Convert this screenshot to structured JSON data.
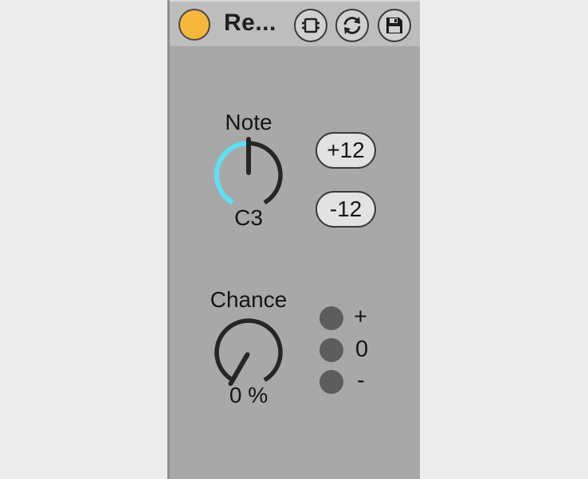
{
  "device": {
    "title": "Re...",
    "power_color": "#f6b73c",
    "toolbar_icons": [
      "hot-swap-icon",
      "refresh-icon",
      "save-preset-icon"
    ]
  },
  "note": {
    "label": "Note",
    "value_text": "C3",
    "knob_fraction": 0.5,
    "arc_color": "#5ee0f5",
    "buttons": {
      "plus": "+12",
      "minus": "-12"
    }
  },
  "chance": {
    "label": "Chance",
    "value_text": "0 %",
    "knob_fraction": 0.0,
    "options": [
      "+",
      "0",
      "-"
    ]
  }
}
